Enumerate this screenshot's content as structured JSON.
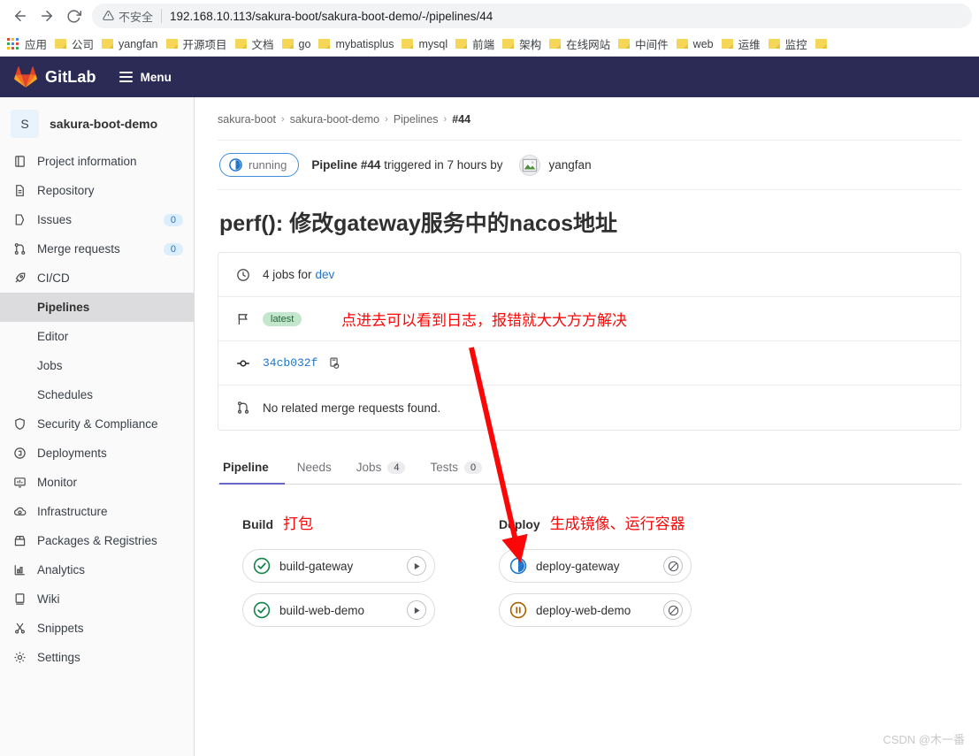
{
  "browser": {
    "nav": {
      "back_icon": "arrow-left-icon",
      "forward_icon": "arrow-right-icon",
      "reload_icon": "reload-icon"
    },
    "omnibox": {
      "security_icon": "warning-triangle-icon",
      "security_label": "不安全",
      "url": "192.168.10.113/sakura-boot/sakura-boot-demo/-/pipelines/44"
    },
    "bookmarks": [
      {
        "label": "应用",
        "icon": "apps-grid-icon"
      },
      {
        "label": "公司",
        "icon": "folder-icon"
      },
      {
        "label": "yangfan",
        "icon": "folder-icon"
      },
      {
        "label": "开源项目",
        "icon": "folder-icon"
      },
      {
        "label": "文档",
        "icon": "folder-icon"
      },
      {
        "label": "go",
        "icon": "folder-icon"
      },
      {
        "label": "mybatisplus",
        "icon": "folder-icon"
      },
      {
        "label": "mysql",
        "icon": "folder-icon"
      },
      {
        "label": "前端",
        "icon": "folder-icon"
      },
      {
        "label": "架构",
        "icon": "folder-icon"
      },
      {
        "label": "在线网站",
        "icon": "folder-icon"
      },
      {
        "label": "中间件",
        "icon": "folder-icon"
      },
      {
        "label": "web",
        "icon": "folder-icon"
      },
      {
        "label": "运维",
        "icon": "folder-icon"
      },
      {
        "label": "监控",
        "icon": "folder-icon"
      }
    ]
  },
  "gitlab_header": {
    "brand": "GitLab",
    "menu_label": "Menu",
    "logo_icon": "gitlab-tanuki-icon",
    "background_color": "#2b2b55"
  },
  "sidebar": {
    "project": {
      "initial": "S",
      "name": "sakura-boot-demo"
    },
    "items": [
      {
        "label": "Project information",
        "icon": "book-icon",
        "count": null
      },
      {
        "label": "Repository",
        "icon": "file-icon",
        "count": null
      },
      {
        "label": "Issues",
        "icon": "issues-icon",
        "count": "0"
      },
      {
        "label": "Merge requests",
        "icon": "merge-request-icon",
        "count": "0"
      },
      {
        "label": "CI/CD",
        "icon": "rocket-icon",
        "count": null
      }
    ],
    "cicd_sub_items": [
      {
        "label": "Pipelines",
        "active": true
      },
      {
        "label": "Editor",
        "active": false
      },
      {
        "label": "Jobs",
        "active": false
      },
      {
        "label": "Schedules",
        "active": false
      }
    ],
    "items_after": [
      {
        "label": "Security & Compliance",
        "icon": "shield-icon",
        "count": null
      },
      {
        "label": "Deployments",
        "icon": "deployments-icon",
        "count": null
      },
      {
        "label": "Monitor",
        "icon": "monitor-icon",
        "count": null
      },
      {
        "label": "Infrastructure",
        "icon": "cloud-gear-icon",
        "count": null
      },
      {
        "label": "Packages & Registries",
        "icon": "package-icon",
        "count": null
      },
      {
        "label": "Analytics",
        "icon": "chart-icon",
        "count": null
      },
      {
        "label": "Wiki",
        "icon": "wiki-book-icon",
        "count": null
      },
      {
        "label": "Snippets",
        "icon": "scissors-icon",
        "count": null
      },
      {
        "label": "Settings",
        "icon": "gear-icon",
        "count": null
      }
    ]
  },
  "breadcrumb": {
    "items": [
      "sakura-boot",
      "sakura-boot-demo",
      "Pipelines"
    ],
    "current": "#44",
    "separator": "›"
  },
  "pipeline": {
    "status_badge": {
      "label": "running",
      "icon": "running-clock-icon",
      "border_color": "#428fdc"
    },
    "trigger_prefix": "Pipeline",
    "pipeline_number": "#44",
    "trigger_middle": "triggered in 7 hours by",
    "author": "yangfan",
    "author_avatar_icon": "broken-image-icon",
    "commit_title": "perf(): 修改gateway服务中的nacos地址",
    "info_rows": {
      "jobs_icon": "clock-icon",
      "jobs_text_prefix": "4 jobs for",
      "jobs_ref": "dev",
      "flag_icon": "flag-icon",
      "latest_tag": "latest",
      "commit_icon": "commit-icon",
      "commit_sha": "34cb032f",
      "copy_icon": "copy-clipboard-icon",
      "mr_icon": "merge-request-icon",
      "mr_text": "No related merge requests found."
    }
  },
  "tabs": [
    {
      "label": "Pipeline",
      "badge": null,
      "active": true
    },
    {
      "label": "Needs",
      "badge": null,
      "active": false
    },
    {
      "label": "Jobs",
      "badge": "4",
      "active": false
    },
    {
      "label": "Tests",
      "badge": "0",
      "active": false
    }
  ],
  "graph": {
    "stages": [
      {
        "title": "Build",
        "note": "打包",
        "jobs": [
          {
            "name": "build-gateway",
            "status": "success",
            "status_icon": "check-circle-icon",
            "action_icon": "play-icon",
            "action": "retry"
          },
          {
            "name": "build-web-demo",
            "status": "success",
            "status_icon": "check-circle-icon",
            "action_icon": "play-icon",
            "action": "retry"
          }
        ]
      },
      {
        "title": "Deploy",
        "note": "生成镜像、运行容器",
        "jobs": [
          {
            "name": "deploy-gateway",
            "status": "running",
            "status_icon": "running-clock-icon",
            "action_icon": "cancel-icon",
            "action": "cancel"
          },
          {
            "name": "deploy-web-demo",
            "status": "pending",
            "status_icon": "pause-circle-icon",
            "action_icon": "cancel-icon",
            "action": "cancel"
          }
        ]
      }
    ]
  },
  "annotations": {
    "note_main": "点进去可以看到日志，报错就大大方方解决",
    "arrow_icon": "red-arrow-icon",
    "color": "#fb0707"
  },
  "watermark": "CSDN @木一番",
  "colors": {
    "gitlab_navy": "#2b2b55",
    "accent_blue": "#1f75cb",
    "success_green": "#108548",
    "pending_orange": "#ab6100",
    "running_blue": "#1f75cb",
    "annotation_red": "#fb0707"
  }
}
